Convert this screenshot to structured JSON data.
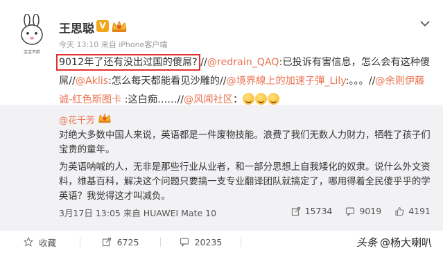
{
  "post": {
    "author": "王思聪",
    "verified_badge": "V",
    "avatar_caption": "宝宝不胖",
    "meta": "今天 13:10 来自 iPhone客户端",
    "text_parts": {
      "highlighted": "9012年了还有没出过国的傻屌?",
      "sep1": " //",
      "mention1": "@redrain_QAQ",
      "t1": ":已投诉有害信息，怎么会有这种傻屌//",
      "mention2": "@Aklis",
      "t2": ":怎么每天都能看见沙雕的//",
      "mention3": "@境界線上的加速子彈_Lily",
      "t3": ":。。。//",
      "mention4": "@余则伊藤诚-红色斯图卡",
      "t4": " :这白痴……//",
      "mention5": "@风闻社区",
      "t5": "："
    }
  },
  "repost": {
    "author": "@花千芳",
    "paragraph1": "对绝大多数中国人来说，英语都是一件废物技能。浪费了我们无数人力财力，牺牲了孩子们宝贵的童年。",
    "paragraph2": "为英语呐喊的人，无非是那些行业从业者，和一部分思想上自我矮化的奴隶。说什么外文资料，维基百科，解决这个问题只要搞一支专业翻译团队就搞定了，哪用得着全民傻乎乎的学英语？我觉得这才叫减负。",
    "footer": "3月17日 13:05 来自 HUAWEI Mate 10",
    "reposts": "15734",
    "comments": "9019",
    "likes": "4191"
  },
  "actions": {
    "favorite": "收藏",
    "repost_count": "6725",
    "comment_count": "20235"
  },
  "watermark": {
    "platform": "头条",
    "account": "@杨大喇叭"
  },
  "colors": {
    "link": "#eb7350",
    "highlight_box": "#e23030",
    "repost_bg": "#f2f2f5",
    "verified": "#f0a81a"
  }
}
